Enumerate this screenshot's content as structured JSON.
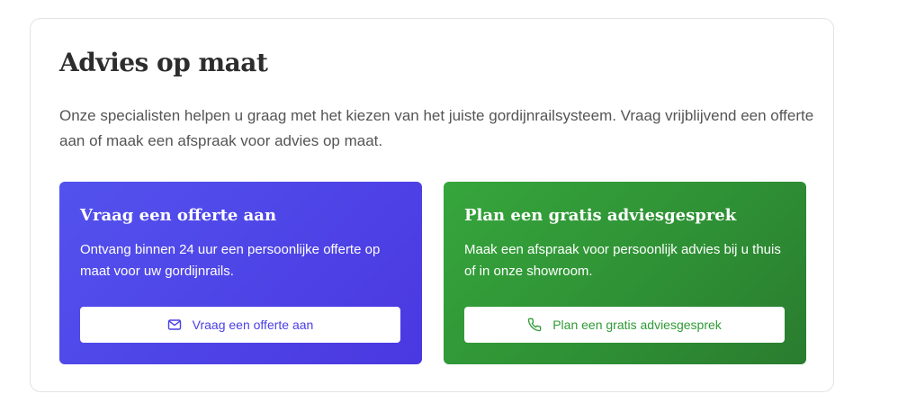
{
  "section": {
    "title": "Advies op maat",
    "intro": "Onze specialisten helpen u graag met het kiezen van het juiste gordijnrailsysteem. Vraag vrijblijvend een offerte aan of maak een afspraak voor advies op maat."
  },
  "quote_panel": {
    "title": "Vraag een offerte aan",
    "text": "Ontvang binnen 24 uur een persoonlijke offerte op maat voor uw gordijnrails.",
    "button_label": "Vraag een offerte aan",
    "icon": "mail-icon",
    "color": "#4a3fe6"
  },
  "consult_panel": {
    "title": "Plan een gratis adviesgesprek",
    "text": "Maak een afspraak voor persoonlijk advies bij u thuis of in onze showroom.",
    "button_label": "Plan een gratis adviesgesprek",
    "icon": "phone-icon",
    "color": "#2f9a35"
  }
}
